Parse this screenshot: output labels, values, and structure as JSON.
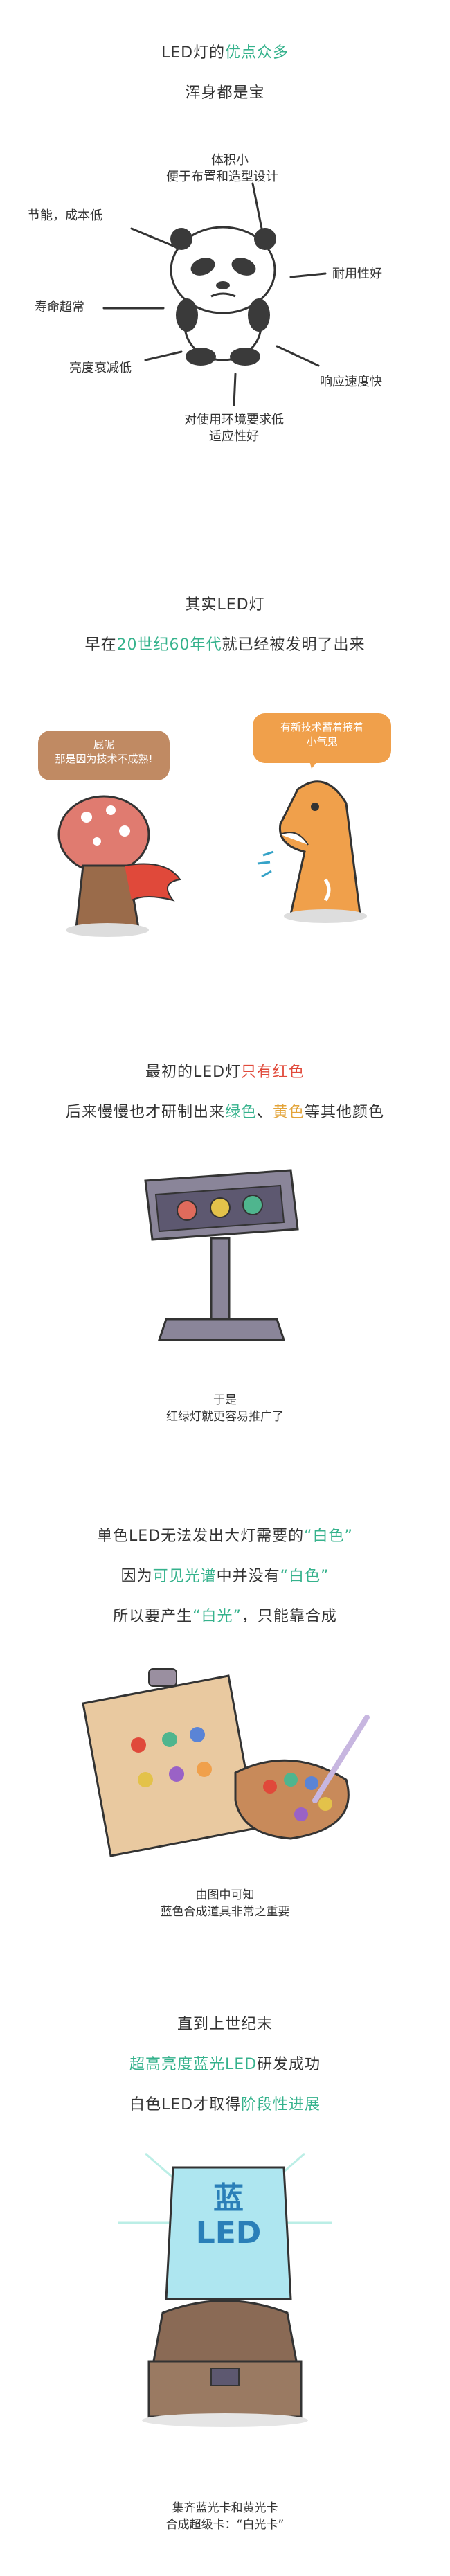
{
  "s1": {
    "title_a": "LED灯的",
    "title_b": "优点众多",
    "subtitle": "浑身都是宝",
    "labels": {
      "small_1": "体积小",
      "small_2": "便于布置和造型设计",
      "energy": "节能，成本低",
      "durable": "耐用性好",
      "life": "寿命超常",
      "decay": "亮度衰减低",
      "response": "响应速度快",
      "env_1": "对使用环境要求低",
      "env_2": "适应性好"
    }
  },
  "s2": {
    "title": "其实LED灯",
    "line_a": "早在",
    "line_b": "20世纪60年代",
    "line_c": "就已经被发明了出来",
    "bubble_left_1": "屁呢",
    "bubble_left_2": "那是因为技术不成熟!",
    "bubble_right_1": "有新技术蓄着掖着",
    "bubble_right_2": "小气鬼"
  },
  "s3": {
    "line1_a": "最初的LED灯",
    "line1_b": "只有红色",
    "line2_a": "后来慢慢也才研制出来",
    "line2_b": "绿色",
    "line2_c": "、",
    "line2_d": "黄色",
    "line2_e": "等其他颜色",
    "cap1": "于是",
    "cap2": "红绿灯就更容易推广了"
  },
  "s4": {
    "line1_a": "单色LED无法发出大灯需要的",
    "line1_b": "“白色”",
    "line2_a": "因为",
    "line2_b": "可见光谱",
    "line2_c": "中并没有",
    "line2_d": "“白色”",
    "line3_a": "所以要产生",
    "line3_b": "“白光”",
    "line3_c": "，只能靠合成",
    "cap1": "由图中可知",
    "cap2": "蓝色合成道具非常之重要"
  },
  "s5": {
    "line1": "直到上世纪末",
    "line2_a": "超高亮度蓝光LED",
    "line2_b": "研发成功",
    "line3_a": "白色LED才取得",
    "line3_b": "阶段性进展",
    "card_top": "蓝",
    "card_bottom": "LED",
    "cap1": "集齐蓝光卡和黄光卡",
    "cap2": "合成超级卡：“白光卡”"
  },
  "colors": {
    "green": "#35b28c",
    "red": "#e0493a",
    "yellow": "#e3a43a",
    "ink": "#333333"
  }
}
